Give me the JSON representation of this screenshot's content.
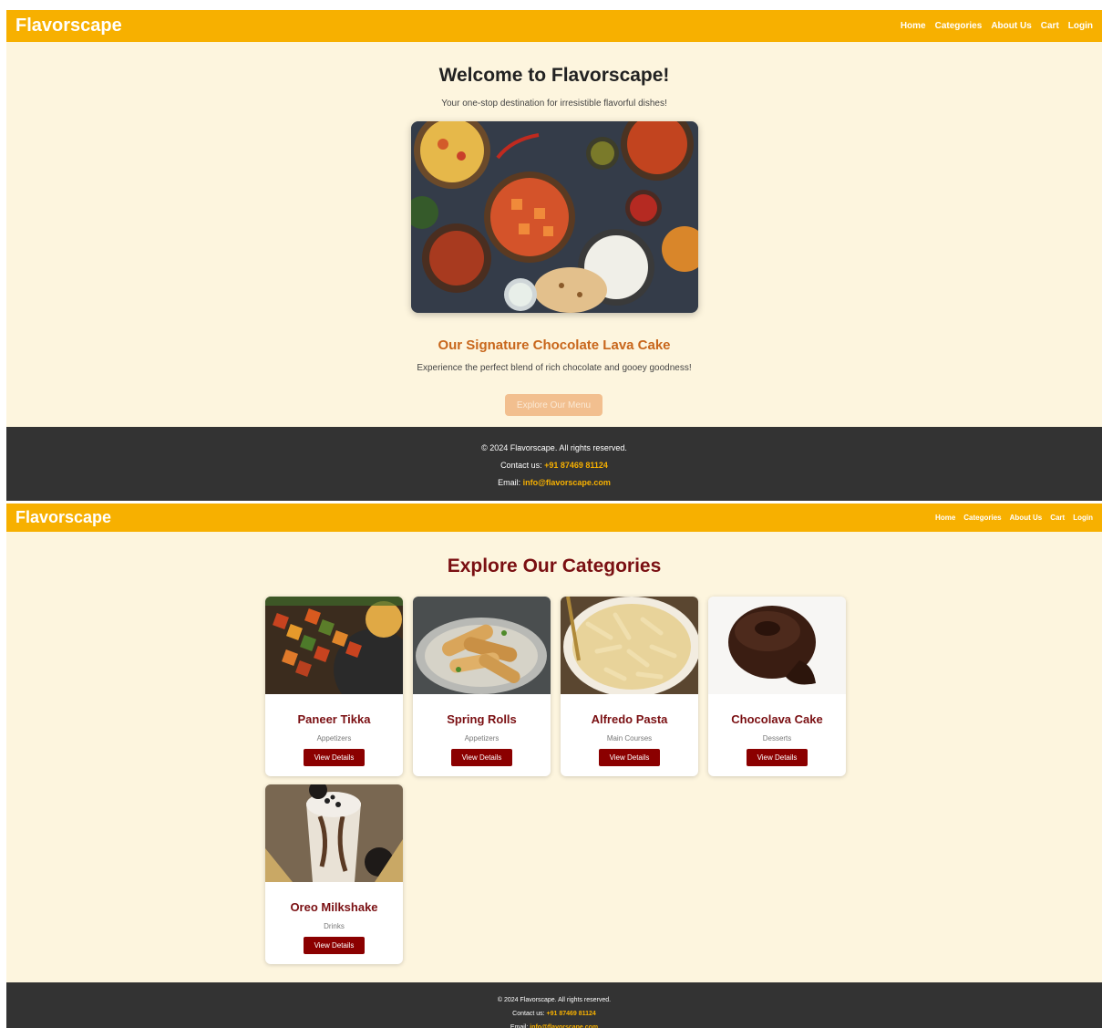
{
  "brand": "Flavorscape",
  "nav": [
    "Home",
    "Categories",
    "About Us",
    "Cart",
    "Login"
  ],
  "home": {
    "title": "Welcome to Flavorscape!",
    "subtitle": "Your one-stop destination for irresistible flavorful dishes!",
    "feature_title": "Our Signature Chocolate Lava Cake",
    "feature_desc": "Experience the perfect blend of rich chocolate and gooey goodness!",
    "cta_label": "Explore Our Menu"
  },
  "footer": {
    "copyright": "© 2024 Flavorscape. All rights reserved.",
    "contact_label": "Contact us: ",
    "phone": "+91 87469 81124",
    "email_label": "Email: ",
    "email": "info@flavorscape.com"
  },
  "categories": {
    "title": "Explore Our Categories",
    "button_label": "View Details",
    "items": [
      {
        "name": "Paneer Tikka",
        "category": "Appetizers"
      },
      {
        "name": "Spring Rolls",
        "category": "Appetizers"
      },
      {
        "name": "Alfredo Pasta",
        "category": "Main Courses"
      },
      {
        "name": "Chocolava Cake",
        "category": "Desserts"
      },
      {
        "name": "Oreo Milkshake",
        "category": "Drinks"
      }
    ]
  },
  "colors": {
    "navbar": "#f7b000",
    "background": "#fdf5de",
    "footer": "#333333",
    "accent_dark_red": "#7a0f12",
    "button_red": "#8b0000",
    "feature_orange": "#c8661b"
  }
}
